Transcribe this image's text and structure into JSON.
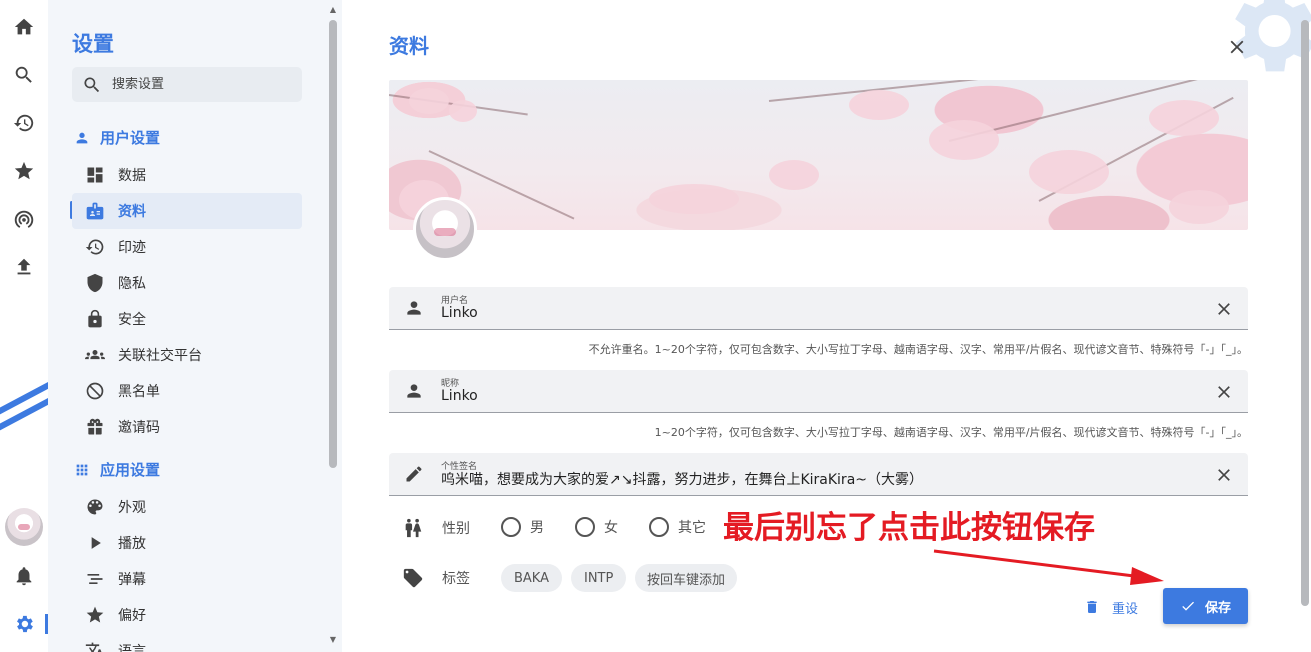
{
  "sidebar": {
    "title": "设置",
    "search_placeholder": "搜索设置",
    "groups": [
      {
        "label": "用户设置"
      },
      {
        "label": "应用设置"
      }
    ],
    "items": [
      {
        "label": "数据"
      },
      {
        "label": "资料"
      },
      {
        "label": "印迹"
      },
      {
        "label": "隐私"
      },
      {
        "label": "安全"
      },
      {
        "label": "关联社交平台"
      },
      {
        "label": "黑名单"
      },
      {
        "label": "邀请码"
      },
      {
        "label": "外观"
      },
      {
        "label": "播放"
      },
      {
        "label": "弹幕"
      },
      {
        "label": "偏好"
      },
      {
        "label": "语言"
      }
    ]
  },
  "main": {
    "title": "资料",
    "fields": [
      {
        "label": "用户名",
        "value": "Linko",
        "hint": "不允许重名。1~20个字符，仅可包含数字、大小写拉丁字母、越南语字母、汉字、常用平/片假名、现代谚文音节、特殊符号「-」「_」。"
      },
      {
        "label": "昵称",
        "value": "Linko",
        "hint": "1~20个字符，仅可包含数字、大小写拉丁字母、越南语字母、汉字、常用平/片假名、现代谚文音节、特殊符号「-」「_」。"
      },
      {
        "label": "个性签名",
        "value": "呜米喵，想要成为大家的爱↗↘抖露，努力进步，在舞台上KiraKira~（大雾）"
      }
    ],
    "gender": {
      "label": "性别",
      "options": [
        "男",
        "女",
        "其它"
      ]
    },
    "tags": {
      "label": "标签",
      "items": [
        "BAKA",
        "INTP"
      ],
      "input_placeholder": "按回车键添加"
    },
    "annotation": "最后别忘了点击此按钮保存",
    "reset_label": "重设",
    "save_label": "保存"
  },
  "colors": {
    "accent": "#3d7ae0",
    "annotation": "#e41b23"
  }
}
